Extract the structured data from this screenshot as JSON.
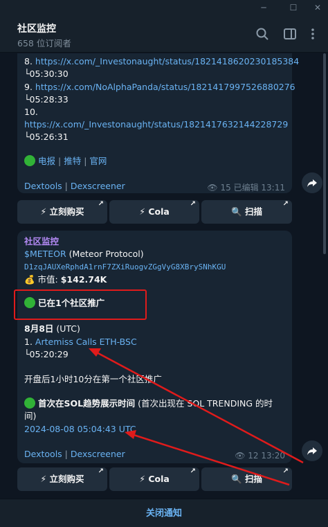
{
  "window": {
    "minimize": "─",
    "maximize": "☐",
    "close": "✕"
  },
  "header": {
    "title": "社区监控",
    "subtitle": "658 位订阅者",
    "icons": [
      "search-icon",
      "sidebar-icon",
      "more-icon"
    ]
  },
  "msg1": {
    "lines": [
      {
        "num": "8.",
        "url": "https://x.com/_Investonaught/status/1821418620230185384",
        "time": "└05:30:30"
      },
      {
        "num": "9.",
        "url": "https://x.com/NoAlphaPanda/status/1821417997526880276",
        "time": "└05:28:33"
      },
      {
        "num": "10.",
        "url": "https://x.com/_Investonaught/status/1821417632144228729",
        "time": "└05:26:31"
      }
    ],
    "links": [
      "电报",
      "推特",
      "官网"
    ],
    "sep": "|",
    "footer_links": [
      "Dextools",
      "Dexscreener"
    ],
    "views": "15",
    "edited": "已编辑 13:11"
  },
  "buttons": {
    "buy": "⚡ 立刻购买",
    "cola": "⚡ Cola",
    "scan": "🔍 扫描",
    "arrow": "↗"
  },
  "msg2": {
    "sender": "社区监控",
    "ticker": "$METEOR",
    "project": " (Meteor Protocol)",
    "address": "D1zqJAUXeRphdA1rnF7ZXiRuogvZGgVyG8XBrySNhKGU",
    "mcap_label": "💰 市值: ",
    "mcap_value": "$142.74K",
    "promoted": "已在1个社区推广",
    "date": "8月8日",
    "tz": " (UTC)",
    "call_num": "1.",
    "call_name": "Artemiss Calls ETH-BSC",
    "call_time": "└05:20:29",
    "note": "开盘后1小时10分在第一个社区推广",
    "trend_title": "首次在SOL趋势展示时间",
    "trend_note": " (首次出现在 SOL TRENDING 的时",
    "trend_note2": "间)",
    "trend_time": "2024-08-08 05:04:43 UTC",
    "footer_links": [
      "Dextools",
      "Dexscreener"
    ],
    "views": "12",
    "time": "13:20"
  },
  "footer": {
    "label": "关闭通知"
  },
  "colors": {
    "accent": "#6ab3f3",
    "annotation": "#e01b1b",
    "green_dot": "#31b237"
  }
}
